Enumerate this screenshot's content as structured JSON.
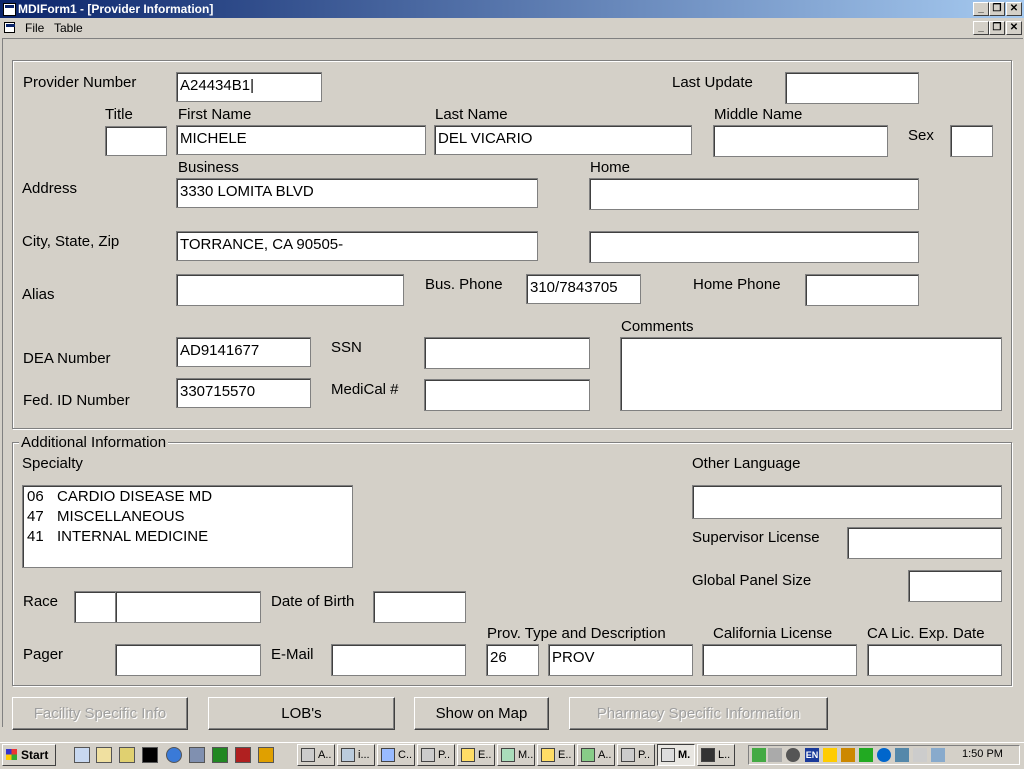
{
  "window": {
    "title": "MDIForm1 - [Provider Information]",
    "min_glyph": "_",
    "restore_glyph": "❐",
    "close_glyph": "✕"
  },
  "menu": [
    "File",
    "Table"
  ],
  "labels": {
    "provider_number": "Provider Number",
    "last_update": "Last Update",
    "title": "Title",
    "first_name": "First Name",
    "last_name": "Last Name",
    "middle_name": "Middle Name",
    "sex": "Sex",
    "address": "Address",
    "business": "Business",
    "home": "Home",
    "city_state_zip": "City, State, Zip",
    "alias": "Alias",
    "bus_phone": "Bus. Phone",
    "home_phone": "Home Phone",
    "comments": "Comments",
    "dea_number": "DEA Number",
    "ssn": "SSN",
    "fed_id": "Fed. ID Number",
    "medical": "MediCal #",
    "additional_info": "Additional Information",
    "specialty": "Specialty",
    "other_language": "Other Language",
    "supervisor_license": "Supervisor License",
    "global_panel_size": "Global Panel Size",
    "race": "Race",
    "date_of_birth": "Date of Birth",
    "pager": "Pager",
    "email": "E-Mail",
    "prov_type": "Prov. Type and Description",
    "california_license": "California License",
    "ca_lic_exp": "CA Lic. Exp. Date"
  },
  "fields": {
    "provider_number": "A24434B1",
    "last_update": "",
    "title": "",
    "first_name": "MICHELE",
    "last_name": "DEL VICARIO",
    "middle_name": "",
    "sex": "",
    "business_address": "3330 LOMITA BLVD",
    "home_address": "",
    "business_city": "TORRANCE, CA 90505-",
    "home_city": "",
    "alias": "",
    "bus_phone": "310/7843705",
    "home_phone": "",
    "comments": "",
    "dea_number": "AD9141677",
    "ssn": "",
    "fed_id": "330715570",
    "medical": "",
    "other_language": "",
    "supervisor_license": "",
    "global_panel_size": "",
    "race_code": "",
    "race_desc": "",
    "date_of_birth": "",
    "pager": "",
    "email": "",
    "prov_type_code": "26",
    "prov_type_desc": "PROV",
    "california_license": "",
    "ca_lic_exp": ""
  },
  "specialties": [
    {
      "code": "06",
      "name": "CARDIO DISEASE MD"
    },
    {
      "code": "47",
      "name": "MISCELLANEOUS"
    },
    {
      "code": "41",
      "name": "INTERNAL MEDICINE"
    }
  ],
  "buttons": {
    "facility": "Facility Specific Info",
    "lobs": "LOB's",
    "show_map": "Show on Map",
    "pharmacy": "Pharmacy Specific Information"
  },
  "taskbar": {
    "start": "Start",
    "tasks": [
      "A..",
      "i...",
      "C..",
      "P..",
      "E..",
      "M..",
      "E..",
      "A..",
      "P..",
      "M.",
      "L.."
    ],
    "active_task_index": 9,
    "tray_language": "EN",
    "clock": "1:50 PM"
  }
}
